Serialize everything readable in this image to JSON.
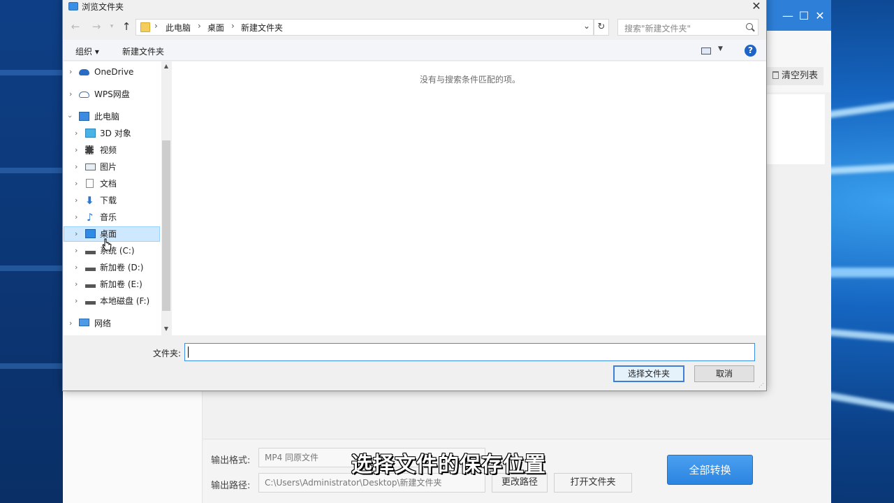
{
  "dialog": {
    "title": "浏览文件夹",
    "breadcrumbs": [
      "此电脑",
      "桌面",
      "新建文件夹"
    ],
    "search_placeholder": "搜索\"新建文件夹\"",
    "toolbar": {
      "organize": "组织 ▾",
      "new_folder": "新建文件夹",
      "help": "?"
    },
    "tree": [
      {
        "label": "OneDrive",
        "icon": "cloud-icon",
        "level": 0,
        "expanded": false
      },
      {
        "label": "WPS网盘",
        "icon": "wps-cloud-icon",
        "level": 0,
        "expanded": false
      },
      {
        "label": "此电脑",
        "icon": "computer-icon",
        "level": 0,
        "expanded": true
      },
      {
        "label": "3D 对象",
        "icon": "3d-objects-icon",
        "level": 1
      },
      {
        "label": "视频",
        "icon": "video-icon",
        "level": 1
      },
      {
        "label": "图片",
        "icon": "pictures-icon",
        "level": 1
      },
      {
        "label": "文档",
        "icon": "documents-icon",
        "level": 1
      },
      {
        "label": "下载",
        "icon": "download-icon",
        "level": 1
      },
      {
        "label": "音乐",
        "icon": "music-icon",
        "level": 1
      },
      {
        "label": "桌面",
        "icon": "desktop-icon",
        "level": 1,
        "selected": true
      },
      {
        "label": "系统 (C:)",
        "icon": "drive-icon",
        "level": 1
      },
      {
        "label": "新加卷 (D:)",
        "icon": "drive-icon",
        "level": 1
      },
      {
        "label": "新加卷 (E:)",
        "icon": "drive-icon",
        "level": 1
      },
      {
        "label": "本地磁盘 (F:)",
        "icon": "drive-icon",
        "level": 1
      },
      {
        "label": "网络",
        "icon": "network-icon",
        "level": 0,
        "expanded": false
      }
    ],
    "empty_message": "没有与搜索条件匹配的项。",
    "folder_label": "文件夹:",
    "folder_value": "",
    "select_button": "选择文件夹",
    "cancel_button": "取消"
  },
  "app": {
    "clear_list": "清空列表",
    "output_format_label": "输出格式:",
    "output_format_value": "MP4   同原文件",
    "output_path_label": "输出路径:",
    "output_path_value": "C:\\Users\\Administrator\\Desktop\\新建文件夹",
    "change_path": "更改路径",
    "open_folder": "打开文件夹",
    "convert_all": "全部转换"
  },
  "subtitle": "选择文件的保存位置",
  "colors": {
    "accent": "#2d7fd8",
    "selection": "#cde8ff",
    "convert_button": "#3a92e8"
  }
}
